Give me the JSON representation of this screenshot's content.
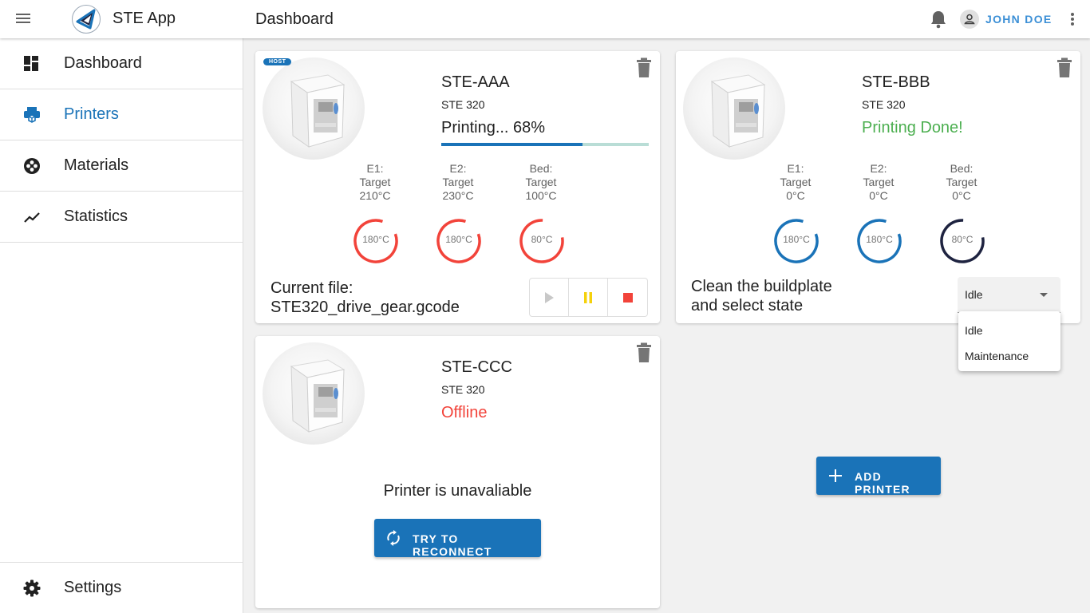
{
  "app": {
    "title": "STE App",
    "page_title": "Dashboard"
  },
  "user": {
    "name": "JOHN DOE"
  },
  "icons": {
    "menu": "menu-icon",
    "bell": "bell-icon",
    "account": "account-icon",
    "more": "more-vertical-icon"
  },
  "sidebar": {
    "items": [
      {
        "label": "Dashboard",
        "icon": "dashboard-icon",
        "active": false
      },
      {
        "label": "Printers",
        "icon": "printer-icon",
        "active": true
      },
      {
        "label": "Materials",
        "icon": "spool-icon",
        "active": false
      },
      {
        "label": "Statistics",
        "icon": "trending-icon",
        "active": false
      }
    ],
    "settings_label": "Settings"
  },
  "colors": {
    "accent": "#1a73b8",
    "hot": "#f2433a",
    "cold": "#1a73b8",
    "dark": "#1e2340",
    "done": "#4caf50",
    "offline": "#f2433a",
    "pause": "#f5d10c"
  },
  "printers": {
    "aaa": {
      "host_badge": "HOST",
      "name": "STE-AAA",
      "model": "STE 320",
      "status": "Printing... 68%",
      "progress": 0.68,
      "temps": [
        {
          "name": "E1:",
          "target_label": "Target",
          "target": "210°C",
          "current": "180°C"
        },
        {
          "name": "E2:",
          "target_label": "Target",
          "target": "230°C",
          "current": "180°C"
        },
        {
          "name": "Bed:",
          "target_label": "Target",
          "target": "100°C",
          "current": "80°C"
        }
      ],
      "file_label": "Current file:",
      "file_name": "STE320_drive_gear.gcode"
    },
    "bbb": {
      "name": "STE-BBB",
      "model": "STE 320",
      "status": "Printing Done!",
      "temps": [
        {
          "name": "E1:",
          "target_label": "Target",
          "target": "0°C",
          "current": "180°C"
        },
        {
          "name": "E2:",
          "target_label": "Target",
          "target": "0°C",
          "current": "180°C"
        },
        {
          "name": "Bed:",
          "target_label": "Target",
          "target": "0°C",
          "current": "80°C"
        }
      ],
      "instruction_line1": "Clean the buildplate",
      "instruction_line2": "and select state",
      "state_select": {
        "value": "Idle",
        "options": [
          "Idle",
          "Maintenance"
        ]
      }
    },
    "ccc": {
      "name": "STE-CCC",
      "model": "STE 320",
      "status": "Offline",
      "unavailable_text": "Printer is unavaliable",
      "reconnect_label": "TRY TO RECONNECT"
    }
  },
  "add_printer_label": "ADD PRINTER"
}
